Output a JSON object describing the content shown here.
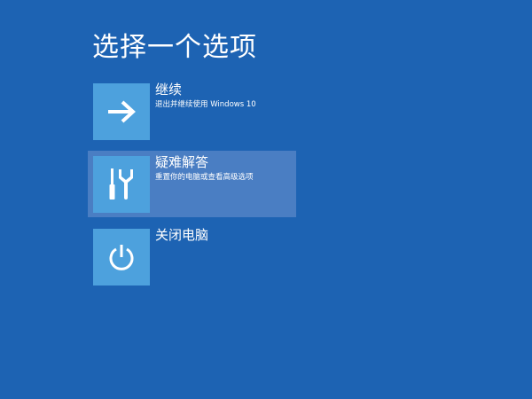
{
  "title": "选择一个选项",
  "options": [
    {
      "label": "继续",
      "subtitle": "退出并继续使用 Windows 10",
      "icon": "arrow-right-icon"
    },
    {
      "label": "疑难解答",
      "subtitle": "重置你的电脑或查看高级选项",
      "icon": "tools-icon"
    },
    {
      "label": "关闭电脑",
      "subtitle": "",
      "icon": "power-icon"
    }
  ],
  "colors": {
    "background": "#1d63b3",
    "tile": "#4da1dd",
    "selected": "#4a7ec3"
  }
}
